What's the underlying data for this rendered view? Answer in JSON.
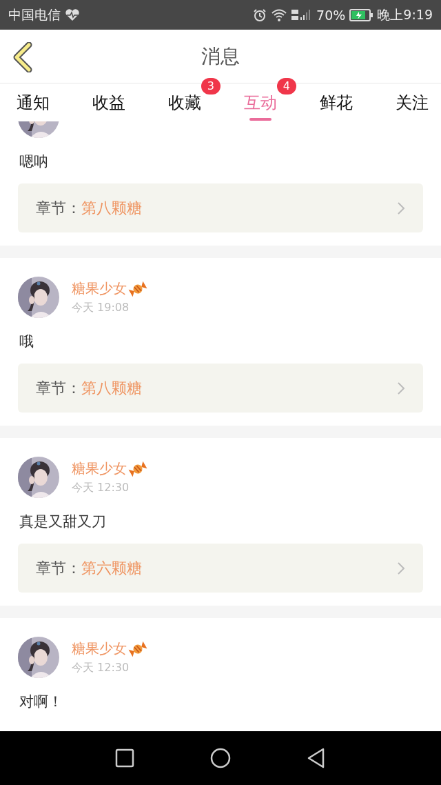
{
  "status_bar": {
    "carrier": "中国电信",
    "battery": "70%",
    "time": "晚上9:19"
  },
  "header": {
    "title": "消息"
  },
  "tabs": [
    {
      "label": "通知",
      "selected": false
    },
    {
      "label": "收益",
      "selected": false
    },
    {
      "label": "收藏",
      "selected": false,
      "badge": "3"
    },
    {
      "label": "互动",
      "selected": true,
      "badge": "4"
    },
    {
      "label": "鲜花",
      "selected": false
    },
    {
      "label": "关注",
      "selected": false
    }
  ],
  "messages": [
    {
      "text": "嗯呐",
      "chapter_label": "章节：",
      "chapter": "第八颗糖"
    },
    {
      "name": "糖果少女",
      "time": "今天 19:08",
      "text": "哦",
      "chapter_label": "章节：",
      "chapter": "第八颗糖"
    },
    {
      "name": "糖果少女",
      "time": "今天 12:30",
      "text": "真是又甜又刀",
      "chapter_label": "章节：",
      "chapter": "第六颗糖"
    },
    {
      "name": "糖果少女",
      "time": "今天 12:30",
      "text": "对啊！"
    }
  ]
}
